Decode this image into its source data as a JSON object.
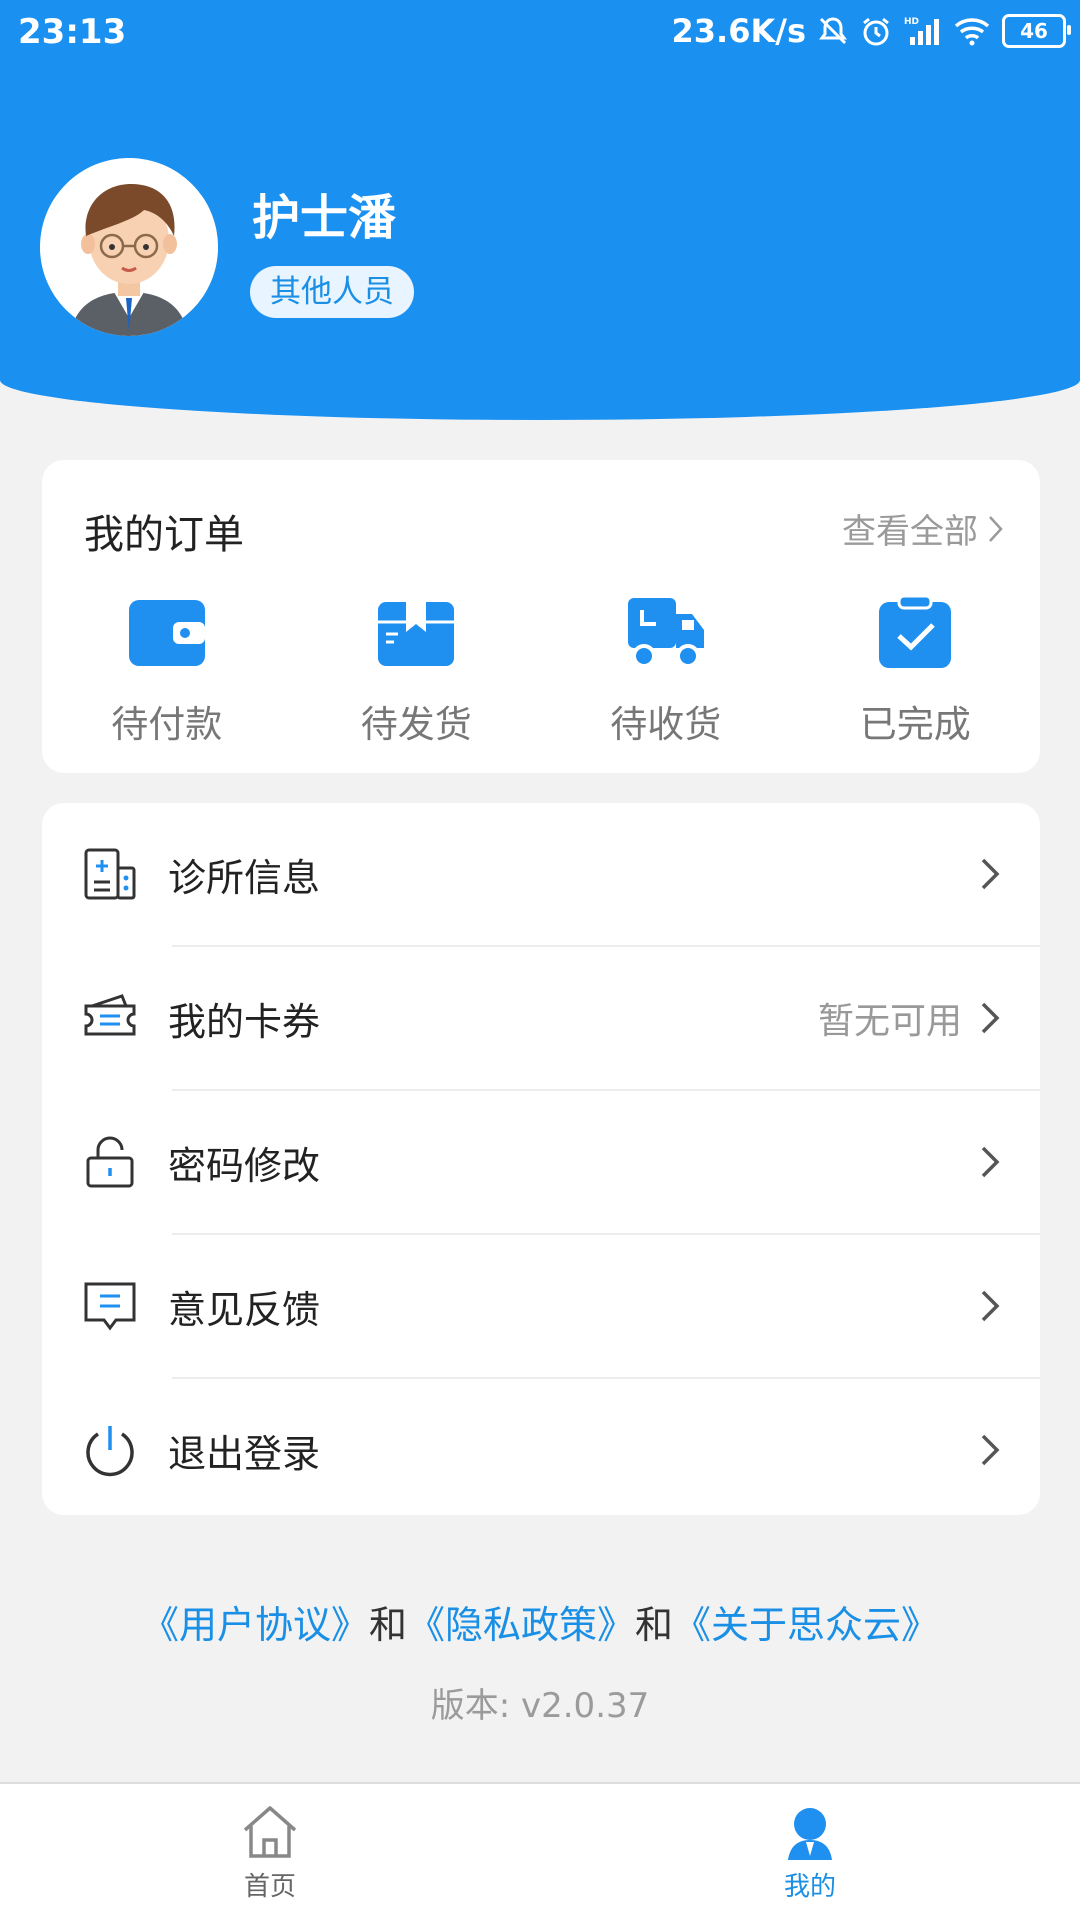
{
  "status_bar": {
    "time": "23:13",
    "network_speed": "23.6K/s",
    "battery": "46",
    "icons": [
      "bell-muted-icon",
      "alarm-icon",
      "hd-signal-icon",
      "wifi-icon",
      "battery-icon"
    ]
  },
  "profile": {
    "name": "护士潘",
    "role": "其他人员"
  },
  "orders": {
    "title": "我的订单",
    "view_all": "查看全部",
    "items": [
      {
        "label": "待付款",
        "icon": "wallet-icon"
      },
      {
        "label": "待发货",
        "icon": "box-icon"
      },
      {
        "label": "待收货",
        "icon": "truck-icon"
      },
      {
        "label": "已完成",
        "icon": "clipboard-check-icon"
      }
    ]
  },
  "menu": [
    {
      "label": "诊所信息",
      "hint": "",
      "icon": "clinic-icon"
    },
    {
      "label": "我的卡券",
      "hint": "暂无可用",
      "icon": "ticket-icon"
    },
    {
      "label": "密码修改",
      "hint": "",
      "icon": "lock-icon"
    },
    {
      "label": "意见反馈",
      "hint": "",
      "icon": "feedback-icon"
    },
    {
      "label": "退出登录",
      "hint": "",
      "icon": "power-icon"
    }
  ],
  "footer": {
    "link1": "《用户协议》",
    "and1": "和",
    "link2": "《隐私政策》",
    "and2": "和",
    "link3": "《关于思众云》",
    "version": "版本: v2.0.37"
  },
  "tabbar": {
    "home": "首页",
    "mine": "我的"
  },
  "colors": {
    "primary": "#1a90f0",
    "icon_blue": "#1f8ff0",
    "background": "#f2f2f2"
  }
}
